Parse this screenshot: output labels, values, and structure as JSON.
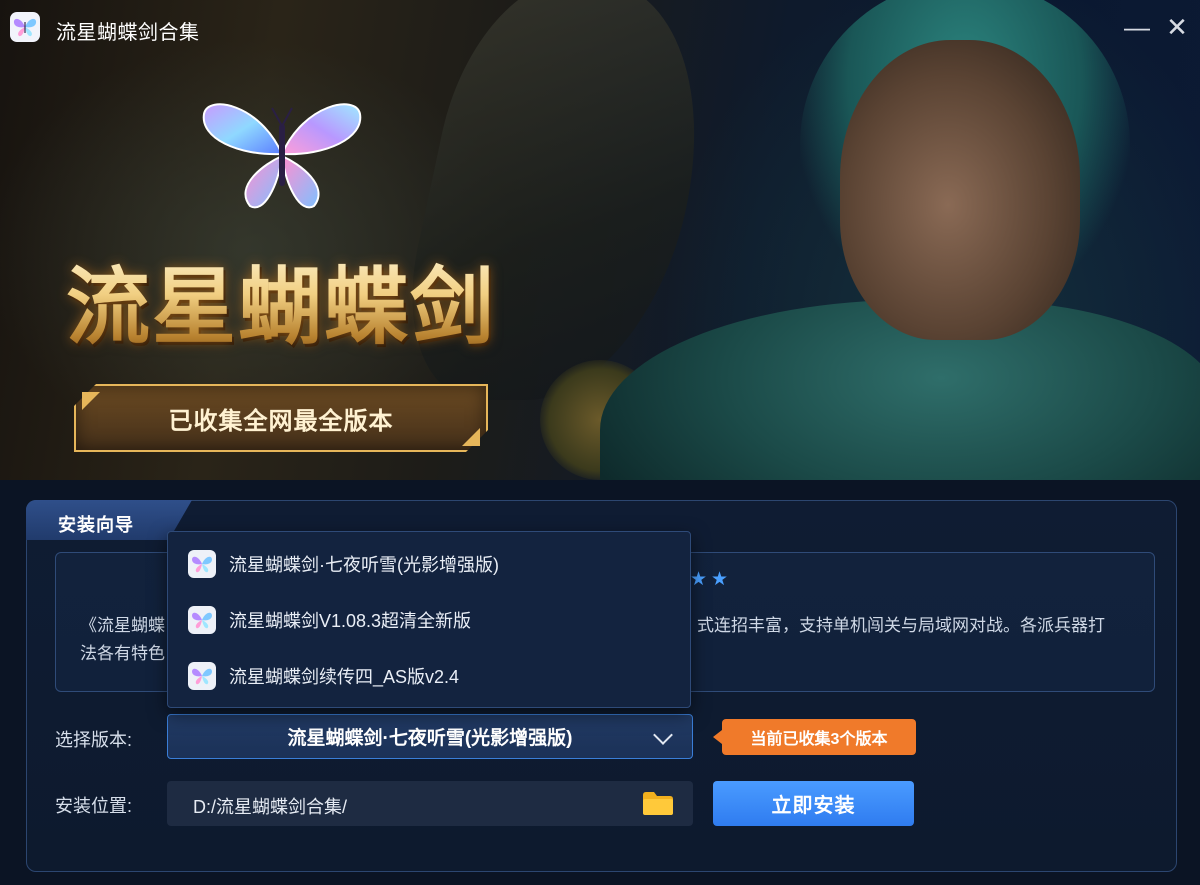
{
  "window": {
    "title": "流星蝴蝶剑合集",
    "minimize_glyph": "—",
    "close_glyph": "✕"
  },
  "banner": {
    "logo_text": "流星蝴蝶剑",
    "badge_text": "已收集全网最全版本"
  },
  "panel": {
    "tab_label": "安装向导",
    "rating_stars": "★★",
    "description_line1": "《流星蝴蝶",
    "description_line1_right": "式连招丰富，支持单机闯关与局域网对战。各派兵器打",
    "description_line2": "法各有特色"
  },
  "version": {
    "label": "选择版本:",
    "selected": "流星蝴蝶剑·七夜听雪(光影增强版)",
    "count_tag": "当前已收集3个版本",
    "options": [
      "流星蝴蝶剑·七夜听雪(光影增强版)",
      "流星蝴蝶剑V1.08.3超清全新版",
      "流星蝴蝶剑续传四_AS版v2.4"
    ]
  },
  "location": {
    "label": "安装位置:",
    "path": "D:/流星蝴蝶剑合集/"
  },
  "actions": {
    "install_label": "立即安装"
  },
  "colors": {
    "accent_blue": "#3a7ed8",
    "install_button": "#2f7cf0",
    "count_tag": "#f07a2a",
    "badge_border": "#e6b65a",
    "background": "#0b1424"
  }
}
